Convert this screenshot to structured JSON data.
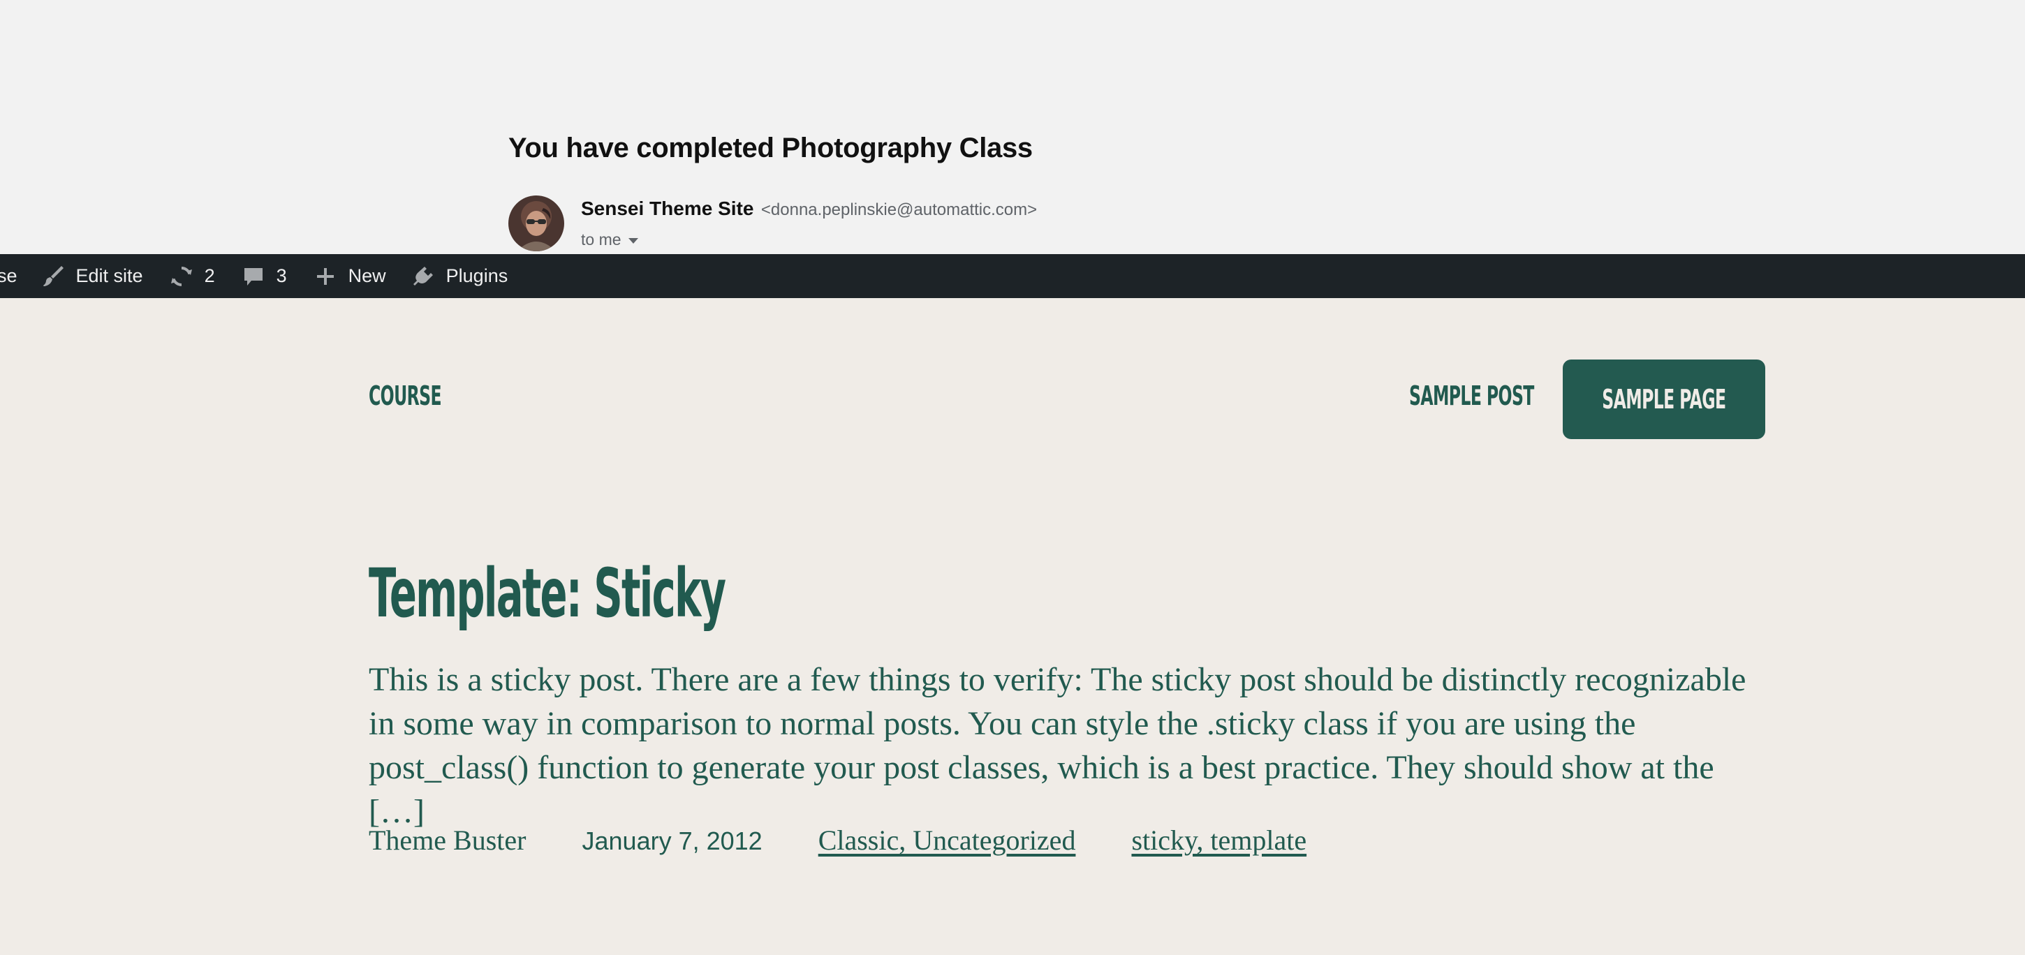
{
  "email": {
    "subject": "You have completed Photography Class",
    "sender_name": "Sensei Theme Site",
    "sender_email": "<donna.peplinskie@automattic.com>",
    "recipient": "to me",
    "avatar_icon": "avatar-photo"
  },
  "admin_bar": {
    "items": [
      {
        "label": "se",
        "icon": "none"
      },
      {
        "label": "Edit site",
        "icon": "brush-icon"
      },
      {
        "label": "2",
        "icon": "updates-icon"
      },
      {
        "label": "3",
        "icon": "comment-icon"
      },
      {
        "label": "New",
        "icon": "plus-icon"
      },
      {
        "label": "Plugins",
        "icon": "plugin-icon"
      }
    ],
    "background": "#1d2327",
    "text_color": "#f0f0f1"
  },
  "site": {
    "title": "COURSE",
    "nav": [
      {
        "label": "SAMPLE POST"
      },
      {
        "label": "SAMPLE PAGE",
        "active": true
      }
    ],
    "accent_color": "#215a4f",
    "background_color": "#f0ece7"
  },
  "post": {
    "title": "Template: Sticky",
    "excerpt": "This is a sticky post. There are a few things to verify: The sticky post should be distinctly recognizable in some way in comparison to normal posts. You can style the .sticky class if you are using the post_class() function to generate your post classes, which is a best practice. They should show at the […]",
    "author": "Theme Buster",
    "date": "January 7, 2012",
    "categories": "Classic, Uncategorized",
    "tags": "sticky, template"
  }
}
